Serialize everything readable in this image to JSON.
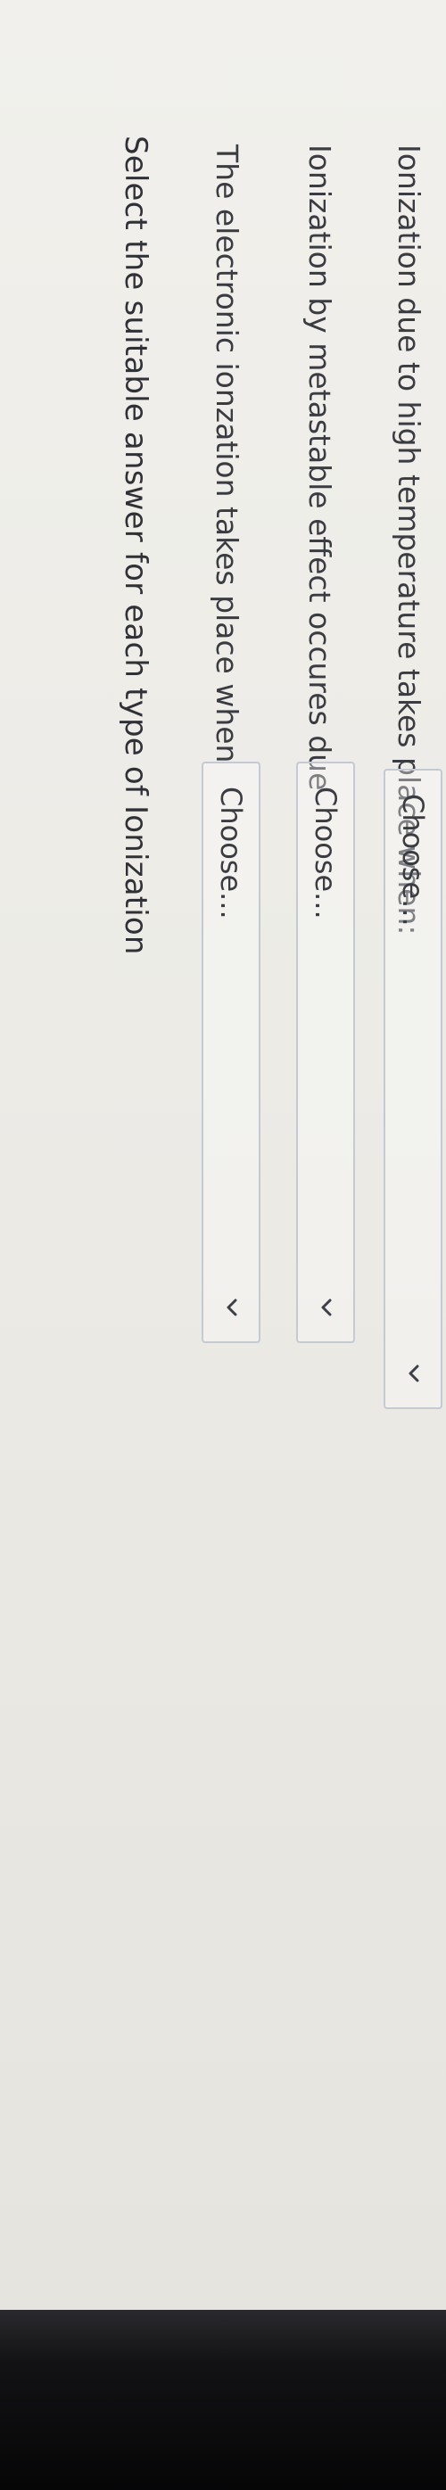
{
  "question": {
    "title": "Select the suitable answer for each type of Ionization"
  },
  "rows": [
    {
      "label": "The electronic ionzation takes place when",
      "select": {
        "value": "Choose..."
      }
    },
    {
      "label": "Ionization by metastable effect occures due",
      "select": {
        "value": "Choose..."
      }
    },
    {
      "label": "Ionization due to high temperature takes place when:",
      "select": {
        "value": "Choose..."
      }
    }
  ],
  "icons": {
    "dropdown": "chevron-down-icon"
  }
}
